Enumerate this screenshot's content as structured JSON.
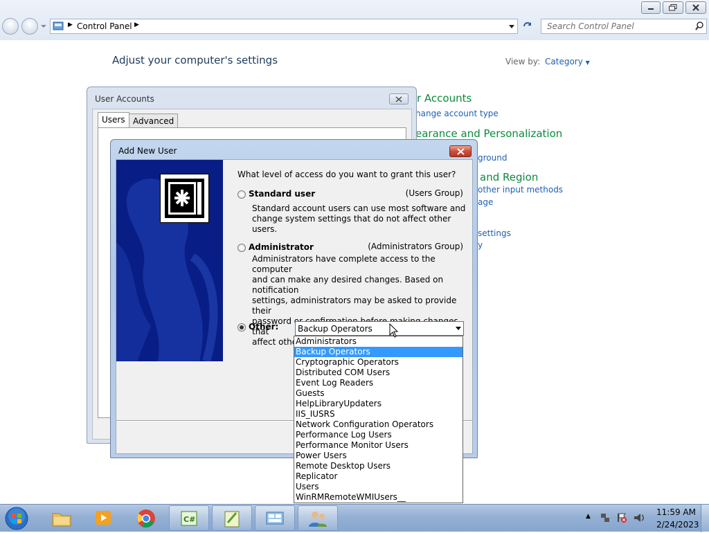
{
  "window": {
    "minimize_icon": "minimize-icon",
    "maximize_icon": "restore-icon",
    "close_icon": "close-icon"
  },
  "address_bar": {
    "path": "Control Panel"
  },
  "search": {
    "placeholder": "Search Control Panel"
  },
  "control_panel": {
    "heading": "Adjust your computer's settings",
    "view_by_label": "View by:",
    "view_by_value": "Category",
    "visible_fragments": [
      "r Accounts",
      "hange account type",
      "earance and Personalization",
      "ground",
      "and Region",
      "other input methods",
      "age",
      "settings",
      "y"
    ]
  },
  "user_accounts_dialog": {
    "title": "User Accounts",
    "tabs": [
      "Users",
      "Advanced"
    ]
  },
  "add_new_user_dialog": {
    "title": "Add New User",
    "question": "What level of access do you want to grant this user?",
    "options": [
      {
        "label": "Standard user",
        "group": "(Users Group)",
        "selected": false,
        "desc_lines": [
          "Standard account users can use most software and",
          "change system settings that do not affect other users."
        ]
      },
      {
        "label": "Administrator",
        "group": "(Administrators Group)",
        "selected": false,
        "desc_lines": [
          "Administrators have complete access to the computer",
          "and can make any desired changes. Based on notification",
          "settings, administrators may be asked to provide their",
          "password or confirmation before making changes that",
          "affect other users."
        ]
      },
      {
        "label": "Other:",
        "selected": true
      }
    ],
    "other_value": "Backup Operators"
  },
  "dropdown": {
    "selected": "Backup Operators",
    "items": [
      "Administrators",
      "Backup Operators",
      "Cryptographic Operators",
      "Distributed COM Users",
      "Event Log Readers",
      "Guests",
      "HelpLibraryUpdaters",
      "IIS_IUSRS",
      "Network Configuration Operators",
      "Performance Log Users",
      "Performance Monitor Users",
      "Power Users",
      "Remote Desktop Users",
      "Replicator",
      "Users",
      "WinRMRemoteWMIUsers__"
    ]
  },
  "taskbar": {
    "apps": [
      {
        "icon": "file-explorer-icon"
      },
      {
        "icon": "media-player-icon"
      },
      {
        "icon": "chrome-icon"
      },
      {
        "icon": "csharp-project-icon"
      },
      {
        "icon": "notepad-plus-plus-icon"
      },
      {
        "icon": "control-panel-icon"
      },
      {
        "icon": "user-accounts-icon"
      }
    ],
    "clock": {
      "time": "11:59 AM",
      "date": "2/24/2023"
    }
  }
}
